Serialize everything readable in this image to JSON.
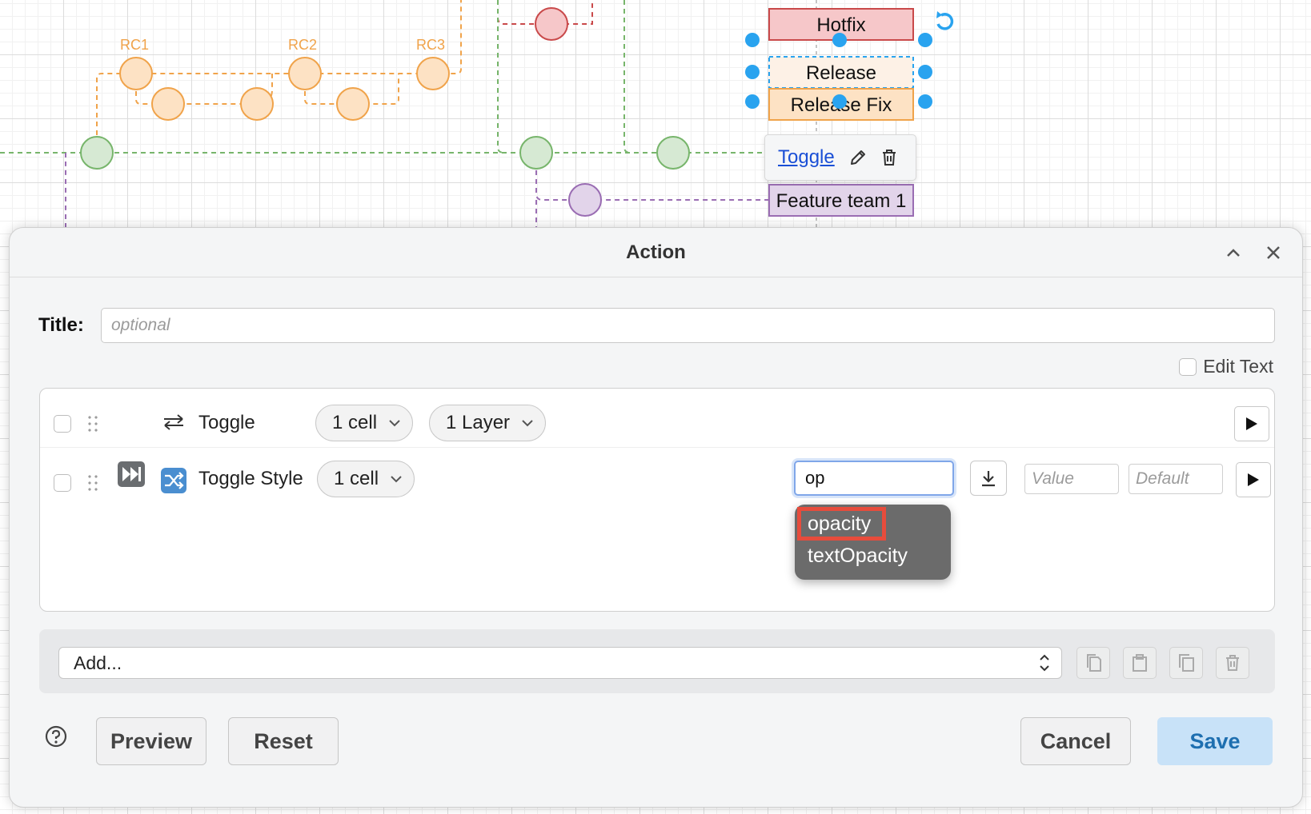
{
  "diagram": {
    "rc_labels": [
      "RC1",
      "RC2",
      "RC3"
    ],
    "shapes": {
      "hotfix": "Hotfix",
      "release": "Release",
      "release_fix": "Release Fix",
      "feature_team": "Feature team 1"
    },
    "colors": {
      "orange": "#f0a34a",
      "orange_fill": "#fde2c4",
      "green": "#77b56b",
      "green_fill": "#d6e9d3",
      "purple": "#9a6db3",
      "purple_fill": "#e2d4ea",
      "red": "#c9494a",
      "red_fill": "#f6c7c9",
      "handle": "#29a3ef"
    }
  },
  "cell_toolbar": {
    "link_label": "Toggle",
    "edit_icon": "pencil-icon",
    "delete_icon": "trash-icon"
  },
  "dialog": {
    "title": "Action",
    "collapse_icon": "chevron-up-icon",
    "close_icon": "close-icon",
    "title_label": "Title:",
    "title_placeholder": "optional",
    "edit_text_label": "Edit Text",
    "steps": [
      {
        "icon": "swap-arrows-icon",
        "label": "Toggle",
        "cells_label": "1 cell",
        "layers_label": "1 Layer"
      },
      {
        "fast_forward_icon": "fast-forward-icon",
        "icon": "shuffle-icon",
        "label": "Toggle Style",
        "cells_label": "1 cell",
        "property_value": "op",
        "value_placeholder": "Value",
        "default_placeholder": "Default"
      }
    ],
    "autocomplete": [
      "opacity",
      "textOpacity"
    ],
    "add_select_label": "Add...",
    "footer": {
      "preview": "Preview",
      "reset": "Reset",
      "cancel": "Cancel",
      "save": "Save"
    },
    "accent_save_bg": "#c8e2f8",
    "accent_focus": "#7fa6e9",
    "highlight": "#e74c3c"
  }
}
